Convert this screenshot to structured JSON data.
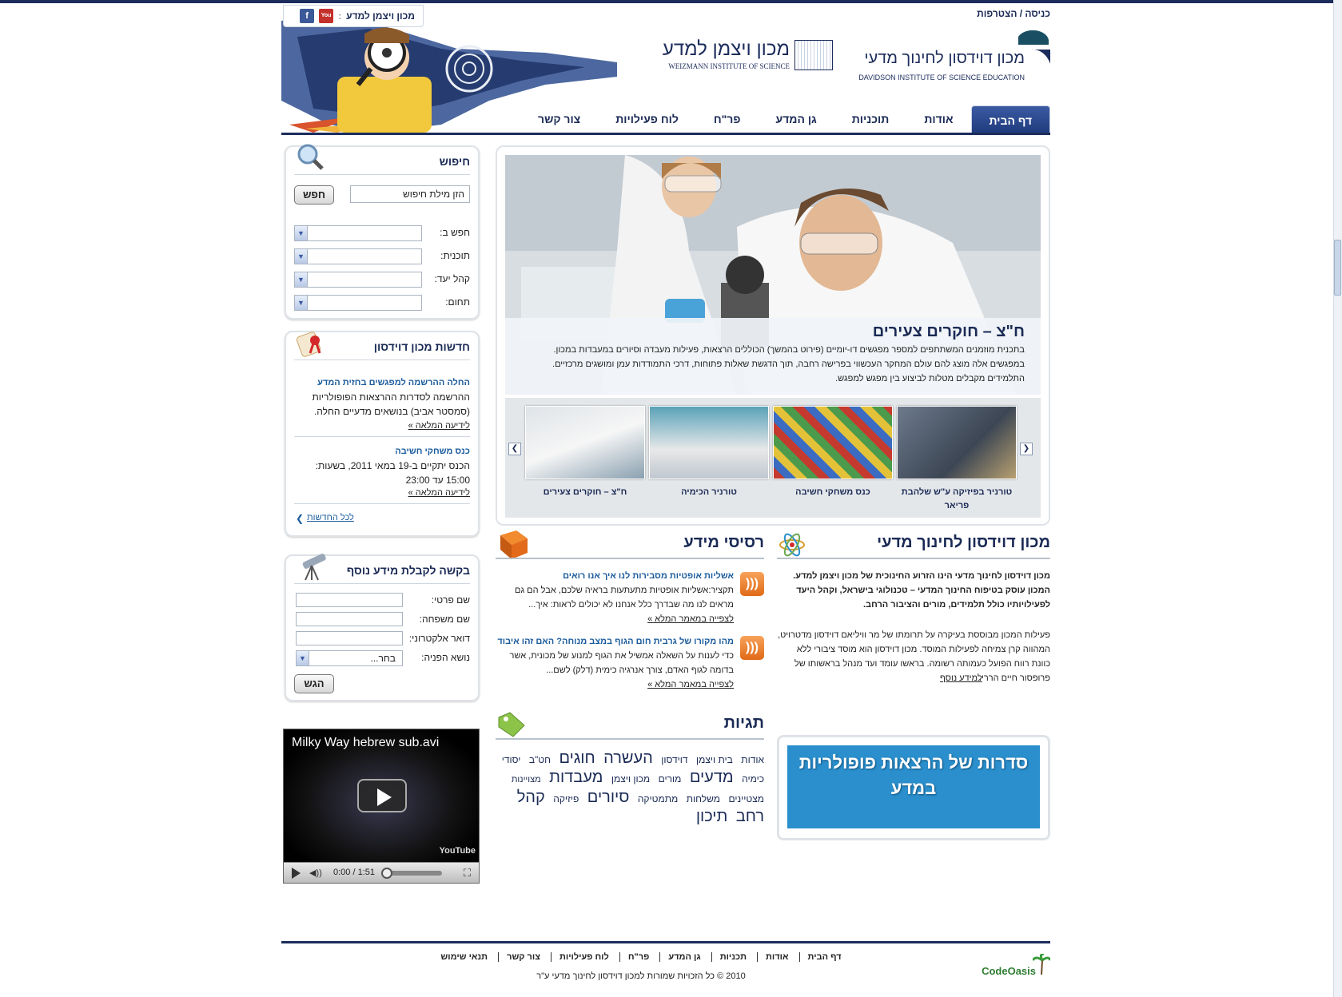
{
  "header": {
    "login_link": "כניסה / הצטרפות",
    "social_label": "מכון ויצמן למדע",
    "davidson_name": "מכון דוידסון לחינוך מדעי",
    "davidson_en": "DAVIDSON INSTITUTE OF SCIENCE EDUCATION",
    "weizmann_name": "מכון ויצמן למדע",
    "weizmann_en": "WEIZMANN INSTITUTE OF SCIENCE"
  },
  "nav": {
    "items": [
      "דף הבית",
      "אודות",
      "תוכניות",
      "גן המדע",
      "פר\"ח",
      "לוח פעילויות",
      "צור קשר"
    ]
  },
  "search": {
    "title": "חיפוש",
    "input_value": "הזן מילת חיפוש",
    "button": "חפש",
    "filters": [
      "חפש ב:",
      "תוכנית:",
      "קהל יעד:",
      "תחום:"
    ]
  },
  "news": {
    "title": "חדשות מכון דוידסון",
    "items": [
      {
        "headline": "החלה ההרשמה למפגשים בחזית המדע",
        "body": "ההרשמה לסדרות ההרצאות הפופולריות (סמסטר אביב) בנושאים מדעיים החלה.",
        "more": "לידיעה המלאה »"
      },
      {
        "headline": "כנס משחקי חשיבה",
        "body": "הכנס יתקיים ב-19 במאי 2011, בשעות: 15:00 עד 23:00",
        "more": "לידיעה המלאה »"
      }
    ],
    "all_news": "לכל החדשות"
  },
  "request": {
    "title": "בקשה לקבלת מידע נוסף",
    "fields": [
      "שם פרטי:",
      "שם משפחה:",
      "דואר אלקטרוני:",
      "נושא הפניה:"
    ],
    "select_value": "בחר...",
    "button": "הגש"
  },
  "video": {
    "title": "Milky Way hebrew sub.avi",
    "time": "0:00 / 1:51",
    "brand": "YouTube"
  },
  "feature": {
    "title": "ח\"צ – חוקרים צעירים",
    "text": "בתכנית מוזמנים המשתתפים למספר מפגשים דו-יומיים (פירוט בהמשך) הכוללים הרצאות, פעילות מעבדה וסיורים במעבדות במכון. במפגשים אלה מוצג להם עולם המחקר העכשווי בפרישה רחבה, תוך הדגשת שאלות פתוחות, דרכי התמודדות עמן ומושגים מרכזיים. התלמידים מקבלים מטלות לביצוע בין מפגש למפגש.",
    "thumbs": [
      "טורניר בפיזיקה ע\"ש שלהבת פריאר",
      "כנס משחקי חשיבה",
      "טורניר הכימיה",
      "ח\"צ – חוקרים צעירים"
    ]
  },
  "about": {
    "title": "מכון דוידסון לחינוך מדעי",
    "p1": "מכון דוידסון לחינוך מדעי הינו הזרוע החינוכית של מכון ויצמן למדע. המכון עוסק בטיפוח החינוך המדעי – טכנולוגי בישראל, וקהל היעד לפעילויותיו כולל תלמידים, מורים והציבור הרחב.",
    "p2": "פעילות המכון מבוססת בעיקרה על תרומתו של מר וויליאם דוידסון מדטרויט, המהווה קרן צמיחה לפעילות המוסד. מכון דוידסון הוא מוסד ציבורי ללא כוונת רווח הפועל כעמותה רשומה. בראשו עומד ועד מנהל בראשותו של פרופסור חיים הררי.",
    "more": "למידע נוסף"
  },
  "rss": {
    "title": "רסיסי מידע",
    "items": [
      {
        "headline": "אשליות אופטיות מסבירות לנו איך אנו רואים",
        "body": "תקציר:אשליות אופטיות מתעתעות בראיה שלכם, אבל הם גם מראים לנו מה שבדרך כלל אנחנו לא יכולים לראות: איך...",
        "more": "לצפייה במאמר המלא »"
      },
      {
        "headline": "מהו מקורו של גרבית חום הגוף במצב מנוחה? האם זהו איבוד ...",
        "body": "כדי לענות על השאלה אמשיל את הגוף למנוע של מכונית, אשר בדומה לגוף האדם, צורך אנרגיה כימית (דלק) לשם...",
        "more": "לצפייה במאמר המלא »"
      }
    ]
  },
  "tags": {
    "title": "תגיות",
    "items": [
      "אודות",
      "בית ויצמן",
      "דוידסון",
      "העשרה",
      "חוגים",
      "חט\"ב",
      "יסודי",
      "כימיה",
      "מדעים",
      "מורים",
      "מכון ויצמן",
      "מעבדות",
      "מצויינות",
      "מצטיינים",
      "משלחות",
      "מתמטיקה",
      "סיורים",
      "פיזיקה",
      "קהל",
      "רחב",
      "תיכון"
    ]
  },
  "banner": {
    "text": "סדרות של הרצאות פופולריות במדע"
  },
  "footer": {
    "links": [
      "דף הבית",
      "אודות",
      "תכניות",
      "גן המדע",
      "פר\"ח",
      "לוח פעילויות",
      "צור קשר",
      "תנאי שימוש"
    ],
    "copyright": "2010 © כל הזכויות שמורות למכון דוידסון לחינוך מדעי ע\"ר",
    "credit": "CodeOasis"
  },
  "colors": {
    "brand_dark": "#1c2c5c",
    "link": "#1a5b9c",
    "banner": "#2a8fcc",
    "rss": "#e87a2a"
  }
}
